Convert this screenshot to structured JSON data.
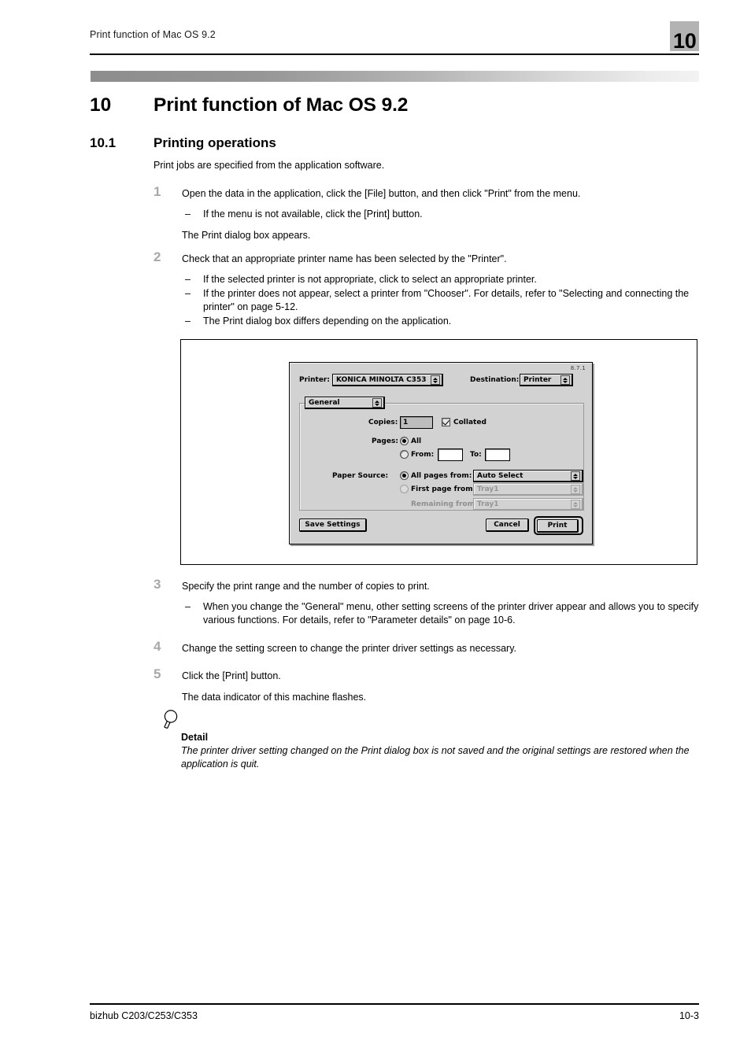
{
  "header": {
    "running_title": "Print function of Mac OS 9.2",
    "chapter_badge": "10"
  },
  "headings": {
    "h1_number": "10",
    "h1_title": "Print function of Mac OS 9.2",
    "h2_number": "10.1",
    "h2_title": "Printing operations"
  },
  "intro": "Print jobs are specified from the application software.",
  "steps": [
    {
      "number": "1",
      "text": "Open the data in the application, click the [File] button, and then click \"Print\" from the menu.",
      "bullets": [
        "If the menu is not available, click the [Print] button."
      ],
      "after": "The Print dialog box appears."
    },
    {
      "number": "2",
      "text": "Check that an appropriate printer name has been selected by the \"Printer\".",
      "bullets": [
        "If the selected printer is not appropriate, click to select an appropriate printer.",
        "If the printer does not appear, select a printer from \"Chooser\". For details, refer to \"Selecting and connecting the printer\" on page 5-12.",
        "The Print dialog box differs depending on the application."
      ],
      "after": ""
    },
    {
      "number": "3",
      "text": "Specify the print range and the number of copies to print.",
      "bullets": [
        "When you change the \"General\" menu, other setting screens of the printer driver appear and allows you to specify various functions. For details, refer to \"Parameter details\" on page 10-6."
      ],
      "after": ""
    },
    {
      "number": "4",
      "text": "Change the setting screen to change the printer driver settings as necessary.",
      "bullets": [],
      "after": ""
    },
    {
      "number": "5",
      "text": "Click the [Print] button.",
      "bullets": [],
      "after": "The data indicator of this machine flashes."
    }
  ],
  "dialog": {
    "version": "8.7.1",
    "printer_label": "Printer:",
    "printer_value": "KONICA MINOLTA C353",
    "destination_label": "Destination:",
    "destination_value": "Printer",
    "pane_value": "General",
    "copies_label": "Copies:",
    "copies_value": "1",
    "collated_label": "Collated",
    "pages_label": "Pages:",
    "pages_all_label": "All",
    "pages_from_label": "From:",
    "pages_from_value": "",
    "pages_to_label": "To:",
    "pages_to_value": "",
    "paper_source_label": "Paper Source:",
    "all_pages_from_label": "All pages from:",
    "all_pages_from_value": "Auto Select",
    "first_page_from_label": "First page from:",
    "first_page_from_value": "Tray1",
    "remaining_from_label": "Remaining from:",
    "remaining_from_value": "Tray1",
    "save_settings_label": "Save Settings",
    "cancel_label": "Cancel",
    "print_label": "Print"
  },
  "detail": {
    "title": "Detail",
    "body": "The printer driver setting changed on the Print dialog box is not saved and the original settings are restored when the application is quit."
  },
  "footer": {
    "left": "bizhub C203/C253/C353",
    "right": "10-3"
  }
}
